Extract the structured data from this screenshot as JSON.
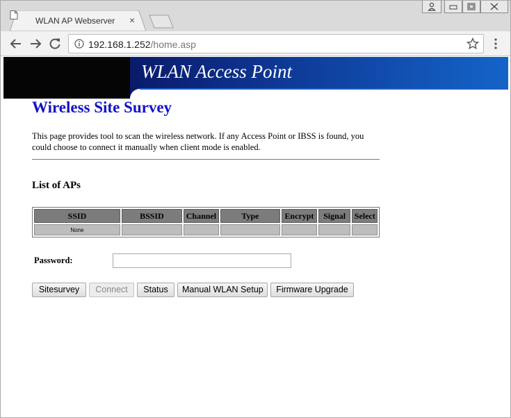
{
  "browser": {
    "tab_title": "WLAN AP Webserver",
    "tab_close": "×",
    "url_host": "192.168.1.252",
    "url_path": "/home.asp",
    "icons": [
      "document-icon",
      "back-icon",
      "forward-icon",
      "reload-icon",
      "info-icon",
      "star-icon",
      "menu-icon",
      "user-icon",
      "minimize-icon",
      "restore-icon",
      "close-icon"
    ]
  },
  "banner": {
    "title": "WLAN Access Point"
  },
  "page": {
    "heading": "Wireless Site Survey",
    "description": "This page provides tool to scan the wireless network. If any Access Point or IBSS is found, you could choose to connect it manually when client mode is enabled.",
    "list_heading": "List of APs",
    "table": {
      "columns": [
        "SSID",
        "BSSID",
        "Channel",
        "Type",
        "Encrypt",
        "Signal",
        "Select"
      ],
      "rows": [
        [
          "None",
          "",
          "",
          "",
          "",
          "",
          ""
        ]
      ]
    },
    "password_label": "Password:",
    "password_value": "",
    "buttons": {
      "sitesurvey": "Sitesurvey",
      "connect": "Connect",
      "status": "Status",
      "manual": "Manual WLAN Setup",
      "firmware": "Firmware Upgrade"
    }
  },
  "colors": {
    "heading": "#1212c8",
    "banner_blue": "#1464c8",
    "header_cell": "#7c7c7c",
    "body_cell": "#bdbdbd"
  }
}
